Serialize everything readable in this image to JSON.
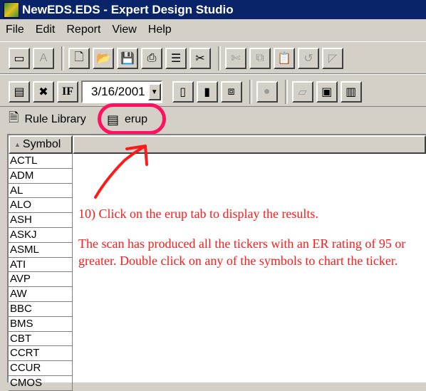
{
  "window": {
    "title": "NewEDS.EDS - Expert Design Studio"
  },
  "menu": [
    "File",
    "Edit",
    "Report",
    "View",
    "Help"
  ],
  "toolbar": {
    "date_value": "3/16/2001",
    "if_label": "IF"
  },
  "tabs": [
    {
      "label": "Rule Library"
    },
    {
      "label": "erup"
    }
  ],
  "table": {
    "column_header": "Symbol",
    "symbols": [
      "ACTL",
      "ADM",
      "AL",
      "ALO",
      "ASH",
      "ASKJ",
      "ASML",
      "ATI",
      "AVP",
      "AW",
      "BBC",
      "BMS",
      "CBT",
      "CCRT",
      "CCUR",
      "CMOS"
    ]
  },
  "annotation": {
    "step": "10) Click on the erup tab to display the results.",
    "note": "The scan has produced all the tickers with an ER rating of 95 or greater. Double click on any of the symbols to chart the ticker.",
    "color": "#ff1a1a"
  },
  "icons": {
    "toolbar_row1": [
      "window-icon",
      "font-icon",
      "new-file-icon",
      "open-folder-icon",
      "save-icon",
      "print-icon",
      "properties-icon",
      "tools-icon",
      "cut-icon",
      "copy-icon",
      "paste-icon",
      "undo-icon",
      "link-icon"
    ],
    "toolbar_row2": [
      "scan-icon",
      "scan-remove-icon",
      "if-icon",
      "calendar-icon",
      "calendar-day-icon",
      "cascade-icon",
      "stop-icon",
      "chart-icon",
      "report-icon",
      "columns-icon"
    ]
  }
}
